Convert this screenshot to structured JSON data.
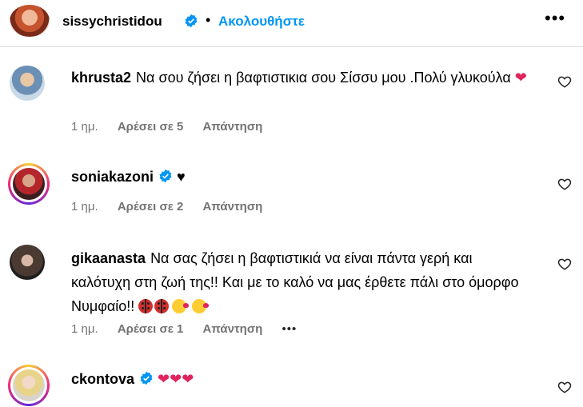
{
  "header": {
    "username": "sissychristidou",
    "separator": "•",
    "follow_label": "Ακολουθήστε",
    "more_label": "•••"
  },
  "colors": {
    "accent": "#0095f6",
    "meta": "#737373",
    "verified": "#0095f6",
    "heart": "#e0245e"
  },
  "comments": [
    {
      "username": "khrusta2",
      "text": "Να σου ζήσει η βαφτιστικια σου Σίσσυ μου .Πολύ γλυκούλα",
      "emoji": "red-heart",
      "verified": false,
      "story_ring": false,
      "time": "1 ημ.",
      "likes": "Αρέσει σε 5",
      "reply": "Απάντηση"
    },
    {
      "username": "soniakazoni",
      "text": "",
      "emoji": "black-heart",
      "verified": true,
      "story_ring": true,
      "time": "1 ημ.",
      "likes": "Αρέσει σε 2",
      "reply": "Απάντηση"
    },
    {
      "username": "gikaanasta",
      "text": "Να σας ζήσει η βαφτιστικιά να είναι πάντα γερή και καλότυχη στη ζωή της!! Και με το καλό να μας έρθετε πάλι στο όμορφο Νυμφαίο!!",
      "emoji": "ladybug-ladybug-kiss-kiss",
      "verified": false,
      "story_ring": false,
      "time": "1 ημ.",
      "likes": "Αρέσει σε 1",
      "reply": "Απάντηση",
      "more": "•••"
    },
    {
      "username": "ckontova",
      "text": "",
      "emoji": "three-red-hearts",
      "verified": true,
      "story_ring": true
    }
  ]
}
